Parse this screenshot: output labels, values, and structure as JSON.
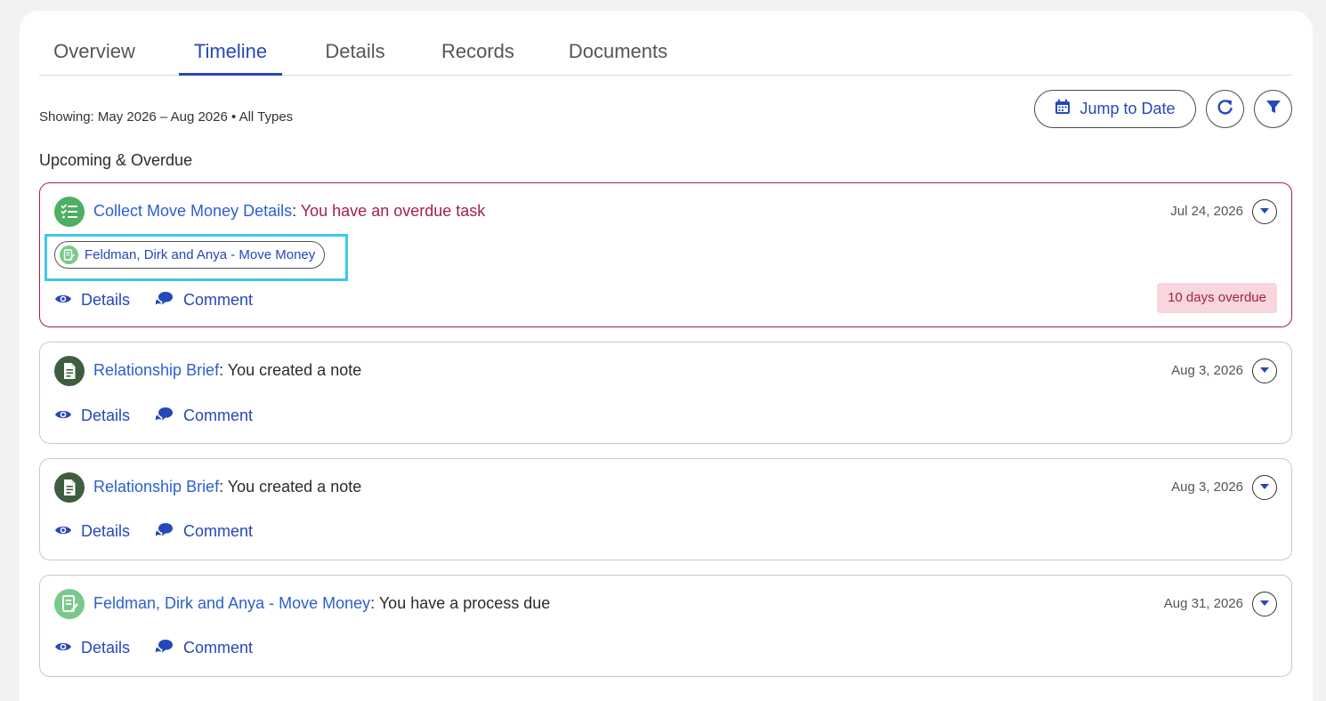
{
  "tabs": [
    "Overview",
    "Timeline",
    "Details",
    "Records",
    "Documents"
  ],
  "active_tab": "Timeline",
  "toolbar": {
    "showing_text": "Showing: May 2026 – Aug 2026 • All Types",
    "jump_label": "Jump to Date",
    "calendar_icon": "calendar-icon",
    "refresh_icon": "refresh-icon",
    "filter_icon": "filter-icon"
  },
  "section_title": "Upcoming & Overdue",
  "action_labels": {
    "details": "Details",
    "comment": "Comment"
  },
  "cards": [
    {
      "icon": "task-list-icon",
      "icon_color": "#4caf63",
      "title_link": "Collect Move Money Details",
      "separator": ": ",
      "message": "You have an overdue task",
      "date": "Jul 24, 2026",
      "chip_label": "Feldman, Dirk and Anya - Move Money",
      "badge": "10 days overdue"
    },
    {
      "icon": "note-icon",
      "icon_color": "#3f5d40",
      "title_link": "Relationship Brief",
      "separator": ": ",
      "message": "You created a note",
      "date": "Aug 3, 2026"
    },
    {
      "icon": "note-icon",
      "icon_color": "#3f5d40",
      "title_link": "Relationship Brief",
      "separator": ": ",
      "message": "You created a note",
      "date": "Aug 3, 2026"
    },
    {
      "icon": "process-doc-icon",
      "icon_color": "#7ac98a",
      "title_link": "Feldman, Dirk and Anya - Move Money",
      "separator": ": ",
      "message": "You have a process due",
      "date": "Aug 31, 2026"
    }
  ],
  "colors": {
    "accent": "#2548b8",
    "link": "#2a5fd1",
    "overdue": "#a3204b",
    "badge_bg": "#f7d6de",
    "highlight": "#3ec7ef"
  }
}
